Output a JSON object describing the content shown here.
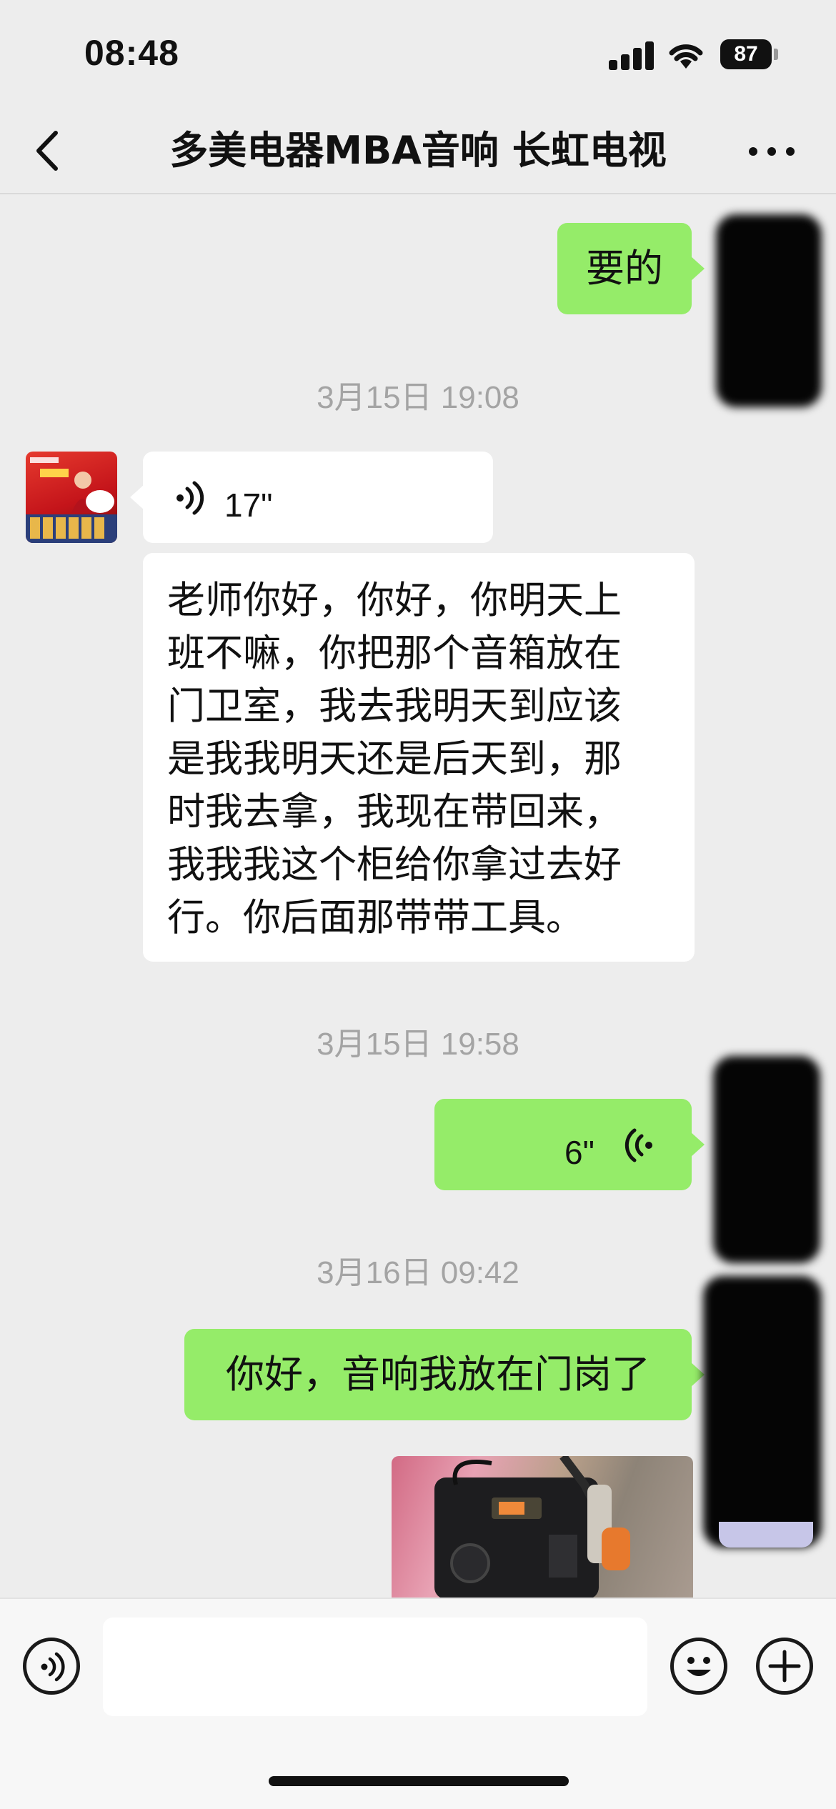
{
  "status_bar": {
    "time": "08:48",
    "battery": "87"
  },
  "chat": {
    "title": "多美电器MBA音响 长虹电视"
  },
  "messages": [
    {
      "type": "text",
      "direction": "out",
      "text": "要的"
    },
    {
      "type": "timestamp",
      "text": "3月15日 19:08"
    },
    {
      "type": "voice",
      "direction": "in",
      "duration": "17\""
    },
    {
      "type": "text",
      "direction": "in",
      "lines": [
        "老师你好，你好，你明天上",
        "班不嘛，你把那个音箱放在",
        "门卫室，我去我明天到应该",
        "是我我明天还是后天到，那",
        "时我去拿，我现在带回来，",
        "我我我这个柜给你拿过去好",
        "行。你后面那带带工具。"
      ]
    },
    {
      "type": "timestamp",
      "text": "3月15日 19:58"
    },
    {
      "type": "voice",
      "direction": "out",
      "duration": "6\""
    },
    {
      "type": "timestamp",
      "text": "3月16日 09:42"
    },
    {
      "type": "text",
      "direction": "out",
      "text": "你好，音响我放在门岗了"
    },
    {
      "type": "image",
      "direction": "out"
    }
  ],
  "input": {
    "placeholder": ""
  },
  "icons": {
    "back": "chevron-left-icon",
    "more": "more-dots-icon",
    "voice_mode": "voice-wave-icon",
    "emoji": "emoji-face-icon",
    "add": "plus-circle-icon"
  },
  "colors": {
    "outgoing_bubble": "#95ec69",
    "incoming_bubble": "#ffffff",
    "background": "#ededed",
    "timestamp": "#a4a4a4"
  }
}
